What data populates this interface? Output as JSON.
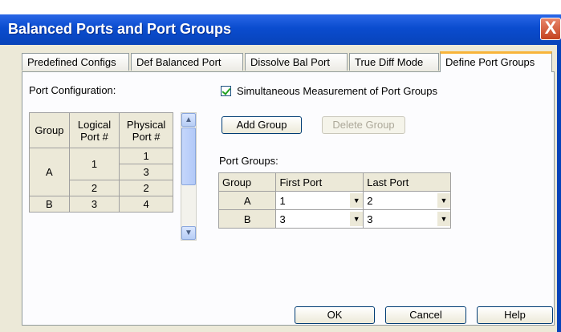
{
  "window": {
    "title": "Balanced Ports and Port Groups",
    "close_glyph": "X"
  },
  "tabs": [
    {
      "label": "Predefined Configs"
    },
    {
      "label": "Def Balanced Port"
    },
    {
      "label": "Dissolve Bal Port"
    },
    {
      "label": "True Diff Mode"
    },
    {
      "label": "Define Port Groups",
      "active": true
    }
  ],
  "port_config": {
    "label": "Port Configuration:",
    "headers": {
      "group": "Group",
      "logical": "Logical Port #",
      "physical": "Physical Port #"
    },
    "rows": [
      {
        "group": "A",
        "logical": "1",
        "physical": [
          "1",
          "3"
        ]
      },
      {
        "logical": "2",
        "physical": "2"
      },
      {
        "group": "B",
        "logical": "3",
        "physical": "4"
      }
    ]
  },
  "simultaneous": {
    "label": "Simultaneous Measurement of Port Groups",
    "checked": true
  },
  "buttons": {
    "add_group": "Add Group",
    "delete_group": "Delete Group",
    "ok": "OK",
    "cancel": "Cancel",
    "help": "Help"
  },
  "port_groups": {
    "label": "Port Groups:",
    "headers": [
      "Group",
      "First Port",
      "Last Port"
    ],
    "rows": [
      {
        "group": "A",
        "first": "1",
        "last": "2"
      },
      {
        "group": "B",
        "first": "3",
        "last": "3"
      }
    ]
  },
  "colors": {
    "titlebar": "#0a4ccf",
    "dialog_bg": "#ece9d8",
    "active_tab_accent": "#f8b43a"
  }
}
